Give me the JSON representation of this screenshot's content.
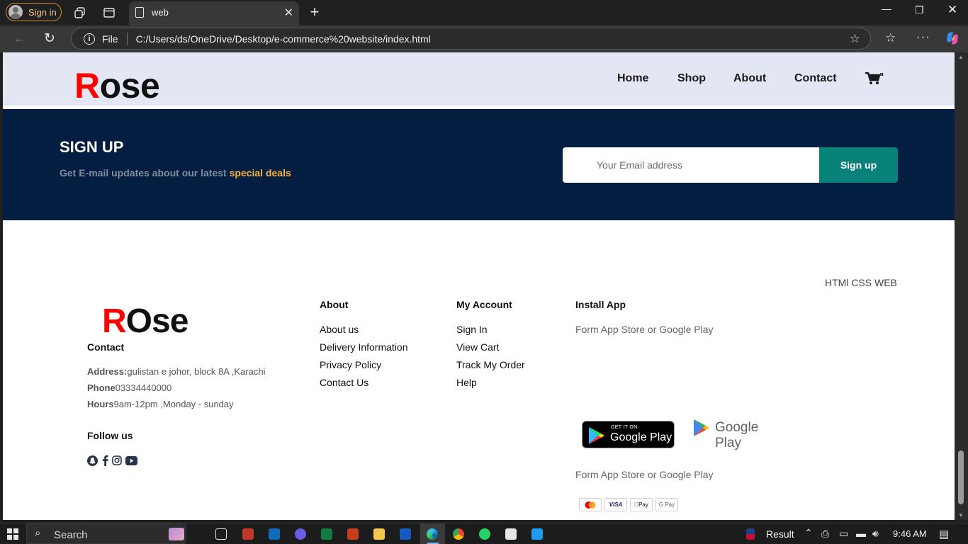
{
  "browser": {
    "signin_label": "Sign in",
    "tab_title": "web",
    "new_tab_symbol": "+",
    "address_prefix": "File",
    "url": "C:/Users/ds/OneDrive/Desktop/e-commerce%20website/index.html"
  },
  "header": {
    "logo_first": "R",
    "logo_rest": "ose",
    "nav": [
      "Home",
      "Shop",
      "About",
      "Contact"
    ],
    "cart_icon": "cart-icon"
  },
  "signup": {
    "title": "SIGN UP",
    "subtitle": "Get E-mail updates about our latest ",
    "highlight": "special deals",
    "email_placeholder": "Your Email address",
    "button_label": "Sign up",
    "colors": {
      "background": "#041e42",
      "button": "#088178",
      "highlight": "#f7b33b"
    }
  },
  "footer": {
    "tagline": "HTMl CSS WEB",
    "logo_first": "R",
    "logo_rest": "Ose",
    "contact_heading": "Contact",
    "address_label": "Address:",
    "address_value": "gulistan e johor, block 8A ,Karachi",
    "phone_label": "Phone",
    "phone_value": "03334440000",
    "hours_label": "Hours",
    "hours_value": "9am-12pm ,Monday - sunday",
    "follow_heading": "Follow us",
    "social_icons": [
      "snapchat-icon",
      "facebook-icon",
      "instagram-icon",
      "youtube-icon"
    ],
    "about_heading": "About",
    "about_links": [
      "About us",
      "Delivery Information",
      "Privacy Policy",
      "Contact Us"
    ],
    "account_heading": "My Account",
    "account_links": [
      "Sign In",
      "View Cart",
      "Track My Order",
      "Help"
    ],
    "app_heading": "Install App",
    "app_text_1": "Form App Store or Google Play",
    "app_text_2": "Form App Store or Google Play",
    "badge_small": "GET IT ON",
    "badge_big": "Google Play",
    "logo_text": "Google Play",
    "payment_cards": [
      "Mastercard",
      "VISA",
      "Apple Pay",
      "G Pay"
    ]
  },
  "taskbar": {
    "search_label": "Search",
    "result_label": "Result",
    "time": "9:46 AM"
  }
}
